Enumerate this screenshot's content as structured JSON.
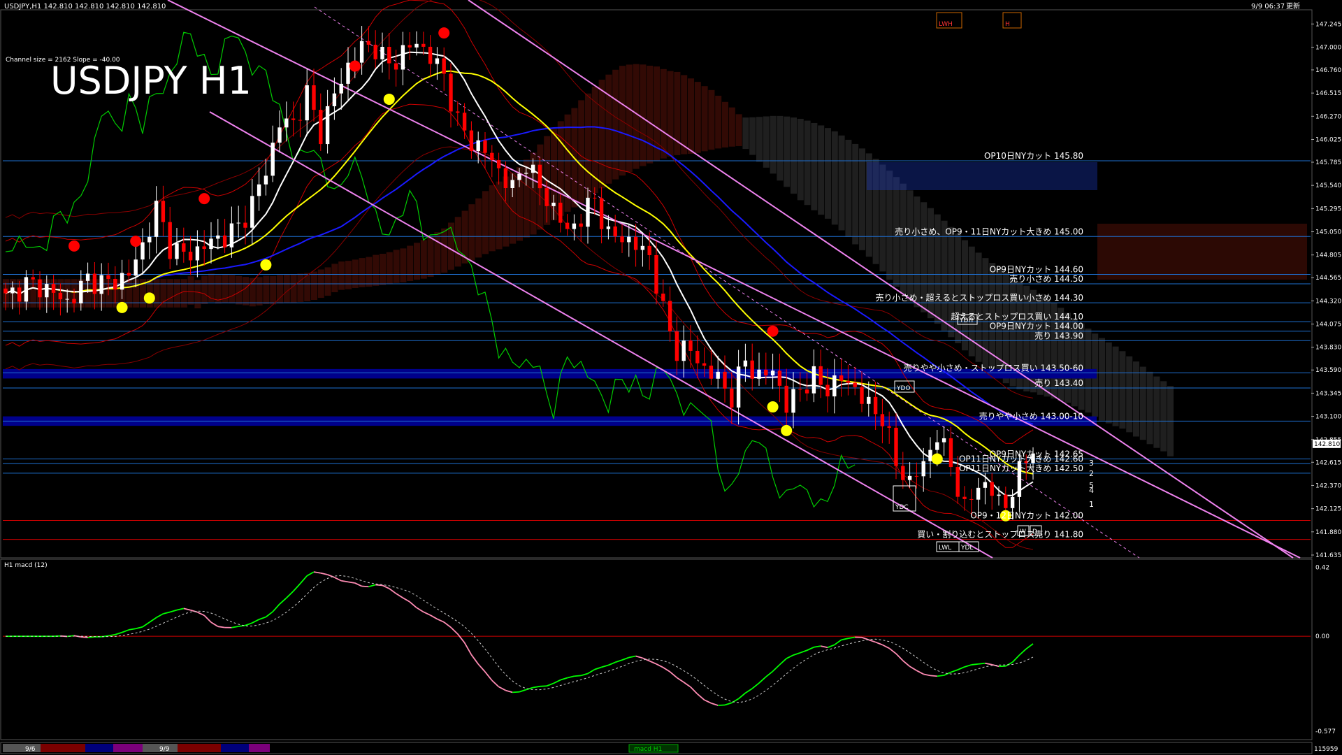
{
  "header": {
    "symbol_info": "USDJPY,H1  142.810 142.810 142.810 142.810",
    "datetime": "9/9 06:37",
    "status": "更新",
    "channel_info": "Channel size = 2162 Slope = -40.00",
    "big_title": "USDJPY H1"
  },
  "colors": {
    "background": "#000000",
    "bull_candle": "#ffffff",
    "bear_candle": "#ff0000",
    "ma_white": "#ffffff",
    "ma_yellow": "#ffff00",
    "ma_blue": "#1a1aff",
    "chikou": "#00cc00",
    "bollinger": "#cc0000",
    "channel": "#ee82ee",
    "band": "#00008b",
    "level_line": "#1e6fd0",
    "macd_up": "#00ff00",
    "macd_down": "#ff8cb4",
    "signal": "#cccccc"
  },
  "price_axis": {
    "ticks": [
      "147.245",
      "147.000",
      "146.760",
      "146.515",
      "146.270",
      "146.025",
      "145.785",
      "145.540",
      "145.295",
      "145.050",
      "144.805",
      "144.565",
      "144.320",
      "144.075",
      "143.830",
      "143.590",
      "143.345",
      "143.100",
      "142.855",
      "142.615",
      "142.370",
      "142.125",
      "141.880",
      "141.635"
    ],
    "current_price": "142.810"
  },
  "annotations": [
    {
      "label": "OP10日NYカット 145.80",
      "price": 145.8
    },
    {
      "label": "売り小さめ、OP9・11日NYカット大きめ 145.00",
      "price": 145.0
    },
    {
      "label": "OP9日NYカット 144.60",
      "price": 144.6
    },
    {
      "label": "売り小さめ 144.50",
      "price": 144.5
    },
    {
      "label": "売り小さめ・超えるとストップロス買い小さめ 144.30",
      "price": 144.3
    },
    {
      "label": "超えるとストップロス買い 144.10",
      "price": 144.1
    },
    {
      "label": "OP9日NYカット 144.00",
      "price": 144.0
    },
    {
      "label": "売り 143.90",
      "price": 143.9
    },
    {
      "label": "売りやや小さめ・ストップロス買い 143.50-60",
      "price": 143.56
    },
    {
      "label": "売り 143.40",
      "price": 143.4
    },
    {
      "label": "売りやや小さめ 143.00-10",
      "price": 143.05
    },
    {
      "label": "OP9日NYカット 142.65",
      "price": 142.65
    },
    {
      "label": "OP11日NYカット大きめ 142.60",
      "price": 142.6
    },
    {
      "label": "OP11日NYカット大きめ 142.50",
      "price": 142.5
    },
    {
      "label": "OP9・12日NYカット 142.00",
      "price": 142.0
    },
    {
      "label": "買い・割り込むとストップロス売り 141.80",
      "price": 141.8
    }
  ],
  "box_labels": [
    "LWH",
    "H",
    "YDH",
    "YDO",
    "YDC",
    "YDL",
    "LWL",
    "W",
    "D"
  ],
  "fib_labels": [
    "3",
    "2",
    "5",
    "4",
    "1"
  ],
  "macd_panel": {
    "title": "H1  macd (12)",
    "ticks": [
      "0.42",
      "0.00",
      "-0.577"
    ]
  },
  "bottom_bar": {
    "dates": [
      "9/6",
      "9/9"
    ],
    "macd_label": "macd H1",
    "volume": "115959"
  },
  "chart_data": {
    "type": "candlestick",
    "title": "USDJPY H1",
    "ylim": [
      141.62,
      147.38
    ],
    "anchors_close": [
      [
        0,
        144.35
      ],
      [
        3,
        144.5
      ],
      [
        6,
        144.45
      ],
      [
        9,
        144.3
      ],
      [
        12,
        144.55
      ],
      [
        15,
        144.5
      ],
      [
        18,
        144.6
      ],
      [
        20,
        144.9
      ],
      [
        22,
        145.3
      ],
      [
        24,
        144.9
      ],
      [
        26,
        144.8
      ],
      [
        28,
        144.85
      ],
      [
        30,
        144.95
      ],
      [
        32,
        145.0
      ],
      [
        34,
        145.1
      ],
      [
        36,
        145.35
      ],
      [
        38,
        145.7
      ],
      [
        40,
        146.2
      ],
      [
        42,
        146.2
      ],
      [
        44,
        146.5
      ],
      [
        46,
        146.1
      ],
      [
        48,
        146.5
      ],
      [
        50,
        146.8
      ],
      [
        52,
        147.0
      ],
      [
        54,
        147.0
      ],
      [
        56,
        146.8
      ],
      [
        58,
        146.95
      ],
      [
        60,
        147.05
      ],
      [
        62,
        146.9
      ],
      [
        64,
        146.7
      ],
      [
        66,
        146.2
      ],
      [
        68,
        146.0
      ],
      [
        70,
        145.9
      ],
      [
        72,
        145.7
      ],
      [
        74,
        145.5
      ],
      [
        76,
        145.8
      ],
      [
        78,
        145.5
      ],
      [
        80,
        145.3
      ],
      [
        82,
        145.05
      ],
      [
        84,
        145.2
      ],
      [
        86,
        145.4
      ],
      [
        88,
        145.0
      ],
      [
        90,
        145.0
      ],
      [
        92,
        144.9
      ],
      [
        94,
        144.8
      ],
      [
        96,
        144.2
      ],
      [
        98,
        143.8
      ],
      [
        100,
        143.8
      ],
      [
        102,
        143.6
      ],
      [
        104,
        143.5
      ],
      [
        106,
        143.3
      ],
      [
        108,
        143.7
      ],
      [
        110,
        143.5
      ],
      [
        112,
        143.6
      ],
      [
        114,
        143.2
      ],
      [
        116,
        143.4
      ],
      [
        118,
        143.5
      ],
      [
        120,
        143.4
      ],
      [
        122,
        143.5
      ],
      [
        124,
        143.4
      ],
      [
        126,
        143.2
      ],
      [
        128,
        143.1
      ],
      [
        130,
        142.6
      ],
      [
        132,
        142.4
      ],
      [
        134,
        142.6
      ],
      [
        136,
        142.9
      ],
      [
        138,
        142.6
      ],
      [
        140,
        142.1
      ],
      [
        142,
        142.4
      ],
      [
        144,
        142.3
      ],
      [
        146,
        142.15
      ],
      [
        148,
        142.5
      ],
      [
        150,
        142.8
      ]
    ],
    "total_candles": 151,
    "channel": {
      "upper_start": [
        0,
        147.55
      ],
      "upper_end": [
        150,
        142.0
      ],
      "lower_start": [
        30,
        146.0
      ],
      "lower_end": [
        150,
        141.55
      ]
    },
    "macd_range": [
      -0.62,
      0.46
    ]
  }
}
